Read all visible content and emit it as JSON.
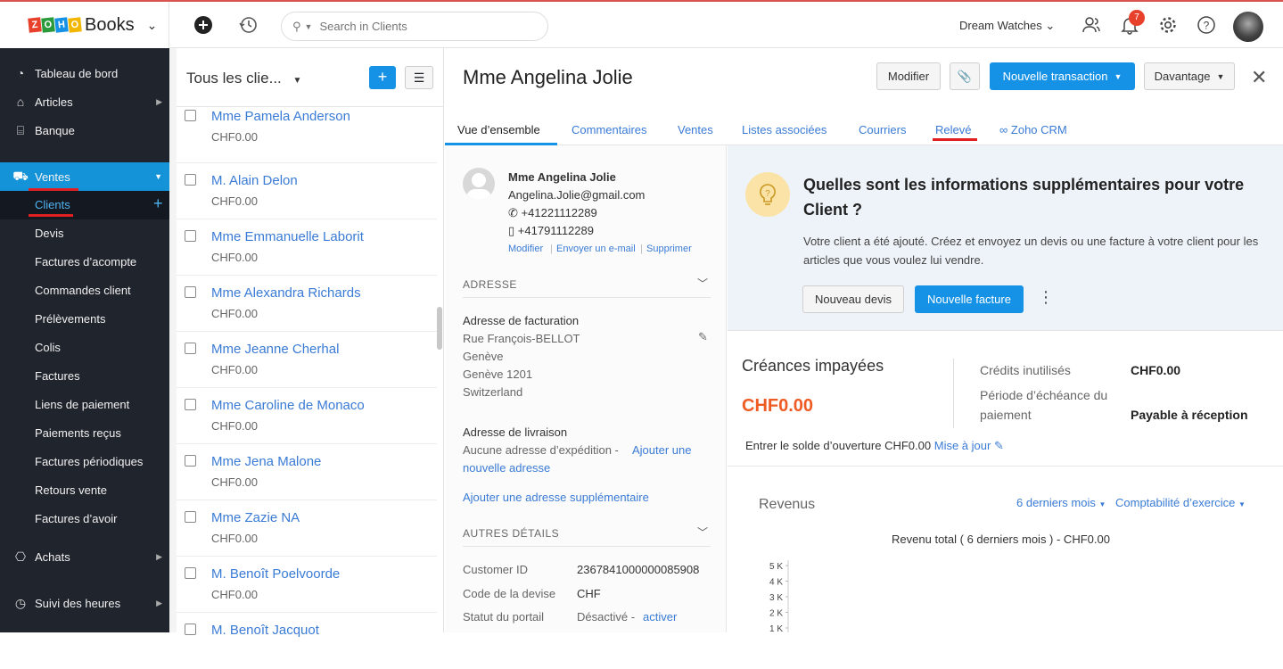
{
  "topbar": {
    "logo_letters": [
      "Z",
      "O",
      "H",
      "O"
    ],
    "logo_colors": [
      "#e8412b",
      "#2a9a3b",
      "#1592e6",
      "#f2b705"
    ],
    "app_name": "Books",
    "search_placeholder": "Search in Clients",
    "org_name": "Dream Watches",
    "notification_count": "7"
  },
  "sidebar": {
    "items": [
      {
        "label": "Tableau de bord",
        "icon": "dashboard-icon",
        "glyph": "◔"
      },
      {
        "label": "Articles",
        "icon": "basket-icon",
        "glyph": "⌂"
      },
      {
        "label": "Banque",
        "icon": "bank-icon",
        "glyph": "⌸"
      },
      {
        "label": "Ventes",
        "icon": "cart-icon",
        "glyph": "🛒"
      },
      {
        "label": "Achats",
        "icon": "bag-icon",
        "glyph": "⎔"
      },
      {
        "label": "Suivi des heures",
        "icon": "stopwatch-icon",
        "glyph": "◷"
      }
    ],
    "sub_items": [
      "Clients",
      "Devis",
      "Factures d’acompte",
      "Commandes client",
      "Prélèvements",
      "Colis",
      "Factures",
      "Liens de paiement",
      "Paiements reçus",
      "Factures périodiques",
      "Retours vente",
      "Factures d’avoir"
    ]
  },
  "list": {
    "title": "Tous les clie...",
    "rows": [
      {
        "name": "Mme Pamela Anderson",
        "amount": "CHF0.00"
      },
      {
        "name": "M. Alain Delon",
        "amount": "CHF0.00"
      },
      {
        "name": "Mme Emmanuelle Laborit",
        "amount": "CHF0.00"
      },
      {
        "name": "Mme Alexandra Richards",
        "amount": "CHF0.00"
      },
      {
        "name": "Mme Jeanne Cherhal",
        "amount": "CHF0.00"
      },
      {
        "name": "Mme Caroline de Monaco",
        "amount": "CHF0.00"
      },
      {
        "name": "Mme Jena Malone",
        "amount": "CHF0.00"
      },
      {
        "name": "Mme Zazie NA",
        "amount": "CHF0.00"
      },
      {
        "name": "M. Benoît Poelvoorde",
        "amount": "CHF0.00"
      },
      {
        "name": "M. Benoît Jacquot",
        "amount": ""
      }
    ]
  },
  "detail": {
    "title": "Mme Angelina Jolie",
    "btn_modify": "Modifier",
    "btn_new_transaction": "Nouvelle transaction",
    "btn_more": "Davantage",
    "tabs": [
      "Vue d’ensemble",
      "Commentaires",
      "Ventes",
      "Listes associées",
      "Courriers",
      "Relevé",
      "Zoho CRM"
    ],
    "contact": {
      "name": "Mme Angelina Jolie",
      "email": "Angelina.Jolie@gmail.com",
      "phone": "+41221112289",
      "mobile": "+41791112289",
      "action_modify": "Modifier",
      "action_email": "Envoyer un e-mail",
      "action_delete": "Supprimer"
    },
    "address": {
      "section": "ADRESSE",
      "billing_label": "Adresse de facturation",
      "billing_lines": [
        "Rue François-BELLOT",
        "Genève",
        "Genève 1201",
        "Switzerland"
      ],
      "shipping_label": "Adresse de livraison",
      "shipping_none": "Aucune adresse d’expédition -",
      "shipping_add_1": "Ajouter une",
      "shipping_add_2": "nouvelle adresse",
      "add_extra": "Ajouter une adresse supplémentaire"
    },
    "other": {
      "section": "AUTRES DÉTAILS",
      "customer_id_label": "Customer ID",
      "customer_id_value": "2367841000000085908",
      "currency_label": "Code de la devise",
      "currency_value": "CHF",
      "portal_label": "Statut du portail",
      "portal_value": "Désactivé -",
      "portal_action": "activer"
    },
    "info": {
      "title": "Quelles sont les informations supplémentaires pour votre Client ?",
      "text": "Votre client a été ajouté. Créez et envoyez un devis ou une facture à votre client pour les articles que vous voulez lui vendre.",
      "btn_quote": "Nouveau devis",
      "btn_invoice": "Nouvelle facture"
    },
    "receivables": {
      "title": "Créances impayées",
      "amount": "CHF0.00",
      "credits_label": "Crédits inutilisés",
      "credits_value": "CHF0.00",
      "term_label_1": "Période d’échéance du",
      "term_label_2": "paiement",
      "term_value": "Payable à réception",
      "opening_text": "Entrer le solde d’ouverture CHF0.00",
      "opening_link": "Mise à jour"
    },
    "revenue": {
      "title": "Revenus",
      "period": "6 derniers mois",
      "basis": "Comptabilité d’exercice",
      "subtitle": "Revenu total ( 6 derniers mois ) - CHF0.00"
    }
  },
  "chart_data": {
    "type": "bar",
    "title": "Revenu total ( 6 derniers mois ) - CHF0.00",
    "ytick_labels": [
      "5 K",
      "4 K",
      "3 K",
      "2 K",
      "1 K"
    ],
    "ylim": [
      0,
      5000
    ],
    "categories": [],
    "values": []
  }
}
